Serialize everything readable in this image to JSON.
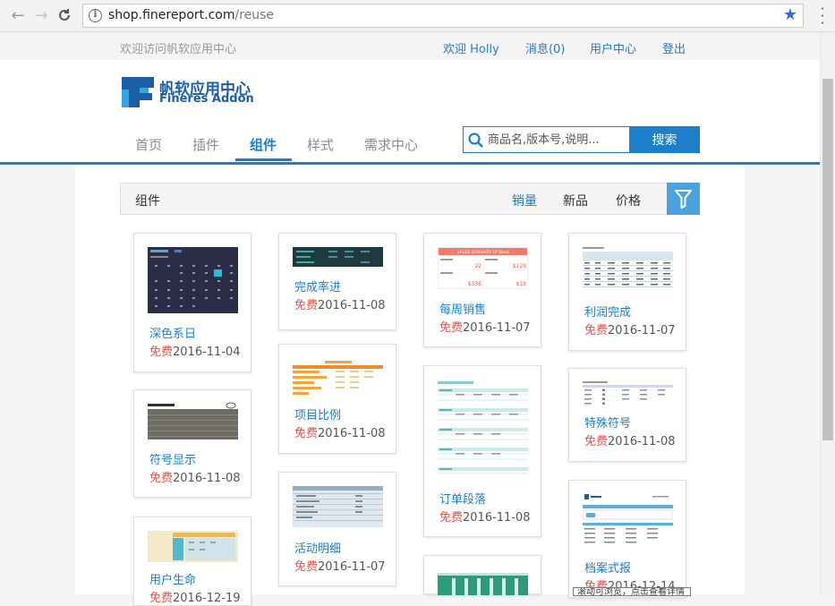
{
  "browser": {
    "url_host": "shop.finereport.com",
    "url_path": "/reuse"
  },
  "topbar": {
    "welcome": "欢迎访问帆软应用中心",
    "greeting": "欢迎 Holly",
    "messages": "消息(0)",
    "user_center": "用户中心",
    "logout": "登出"
  },
  "brand": {
    "name_cn": "帆软应用中心",
    "name_en": "Fineres Addon",
    "color": "#1a5fa6"
  },
  "nav": {
    "tabs": [
      {
        "label": "首页"
      },
      {
        "label": "插件"
      },
      {
        "label": "组件"
      },
      {
        "label": "样式"
      },
      {
        "label": "需求中心"
      }
    ],
    "active": "组件"
  },
  "search": {
    "placeholder": "商品名,版本号,说明...",
    "button": "搜索"
  },
  "filterbar": {
    "title": "组件",
    "sort_options": [
      "销量",
      "新品",
      "价格"
    ],
    "active_sort": "销量"
  },
  "cards": [
    {
      "name": "深色系日",
      "price": "免费",
      "date": "2016-11-04"
    },
    {
      "name": "符号显示",
      "price": "免费",
      "date": "2016-11-08"
    },
    {
      "name": "用户生命",
      "price": "免费",
      "date": "2016-12-19"
    },
    {
      "name": "完成率进",
      "price": "免费",
      "date": "2016-11-08"
    },
    {
      "name": "项目比例",
      "price": "免费",
      "date": "2016-11-08"
    },
    {
      "name": "活动明细",
      "price": "免费",
      "date": "2016-11-07"
    },
    {
      "name": "每周销售",
      "price": "免费",
      "date": "2016-11-07"
    },
    {
      "name": "订单段落",
      "price": "免费",
      "date": "2016-11-08"
    },
    {
      "name": "利润完成",
      "price": "免费",
      "date": "2016-11-07"
    },
    {
      "name": "特殊符号",
      "price": "免费",
      "date": "2016-11-08"
    },
    {
      "name": "档案式报",
      "price": "免费",
      "date": "2016-12-14"
    }
  ],
  "thumb_texts": {
    "weekly_sales_header": "SALES SUMMARY Of Week",
    "weekly_vals": [
      "22",
      "$129",
      "$336",
      "$19"
    ]
  },
  "tooltip": "滚动可浏览，点击查看详情",
  "colors": {
    "accent": "#1b7fc9",
    "free": "#e5534b"
  }
}
